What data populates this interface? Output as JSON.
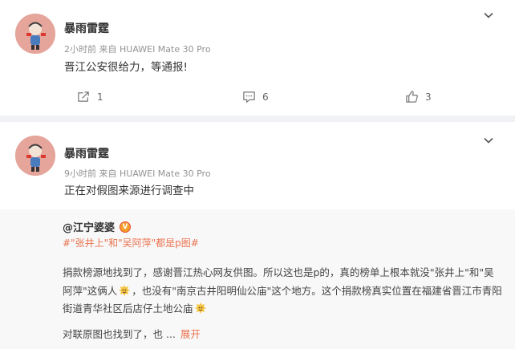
{
  "post1": {
    "username": "暴雨雷霆",
    "meta": "2小时前 来自 HUAWEI Mate 30 Pro",
    "text": "晋江公安很给力，等通报!",
    "reposts": "1",
    "comments": "6",
    "likes": "3"
  },
  "post2": {
    "username": "暴雨雷霆",
    "meta": "9小时前 来自 HUAWEI Mate 30 Pro",
    "text": "正在对假图来源进行调查中",
    "quote": {
      "author": "@江宁婆婆",
      "verified_badge": "V",
      "topic": "#\"张井上\"和\"吴阿萍\"都是p图#",
      "body_part1": "捐款榜源地找到了，感谢晋江热心网友供图。所以这也是p的，真的榜单上根本就没\"张井上\"和\"吴阿萍\"这俩人",
      "body_part2": "，也没有\"南京古井阳明仙公庙\"这个地方。这个捐款榜真实位置在福建省晋江市青阳街道青华社区后店仔土地公庙",
      "more_text": "对联原图也找到了，也 ...",
      "expand_label": "展开"
    }
  },
  "icons": {
    "repost": "repost-icon",
    "comment": "comment-icon",
    "like": "thumbs-up-icon",
    "menu": "chevron-down-icon",
    "emoji": "emoji-icon"
  },
  "colors": {
    "accent": "#eb7350",
    "verified": "#f49f2c",
    "meta": "#939393"
  }
}
